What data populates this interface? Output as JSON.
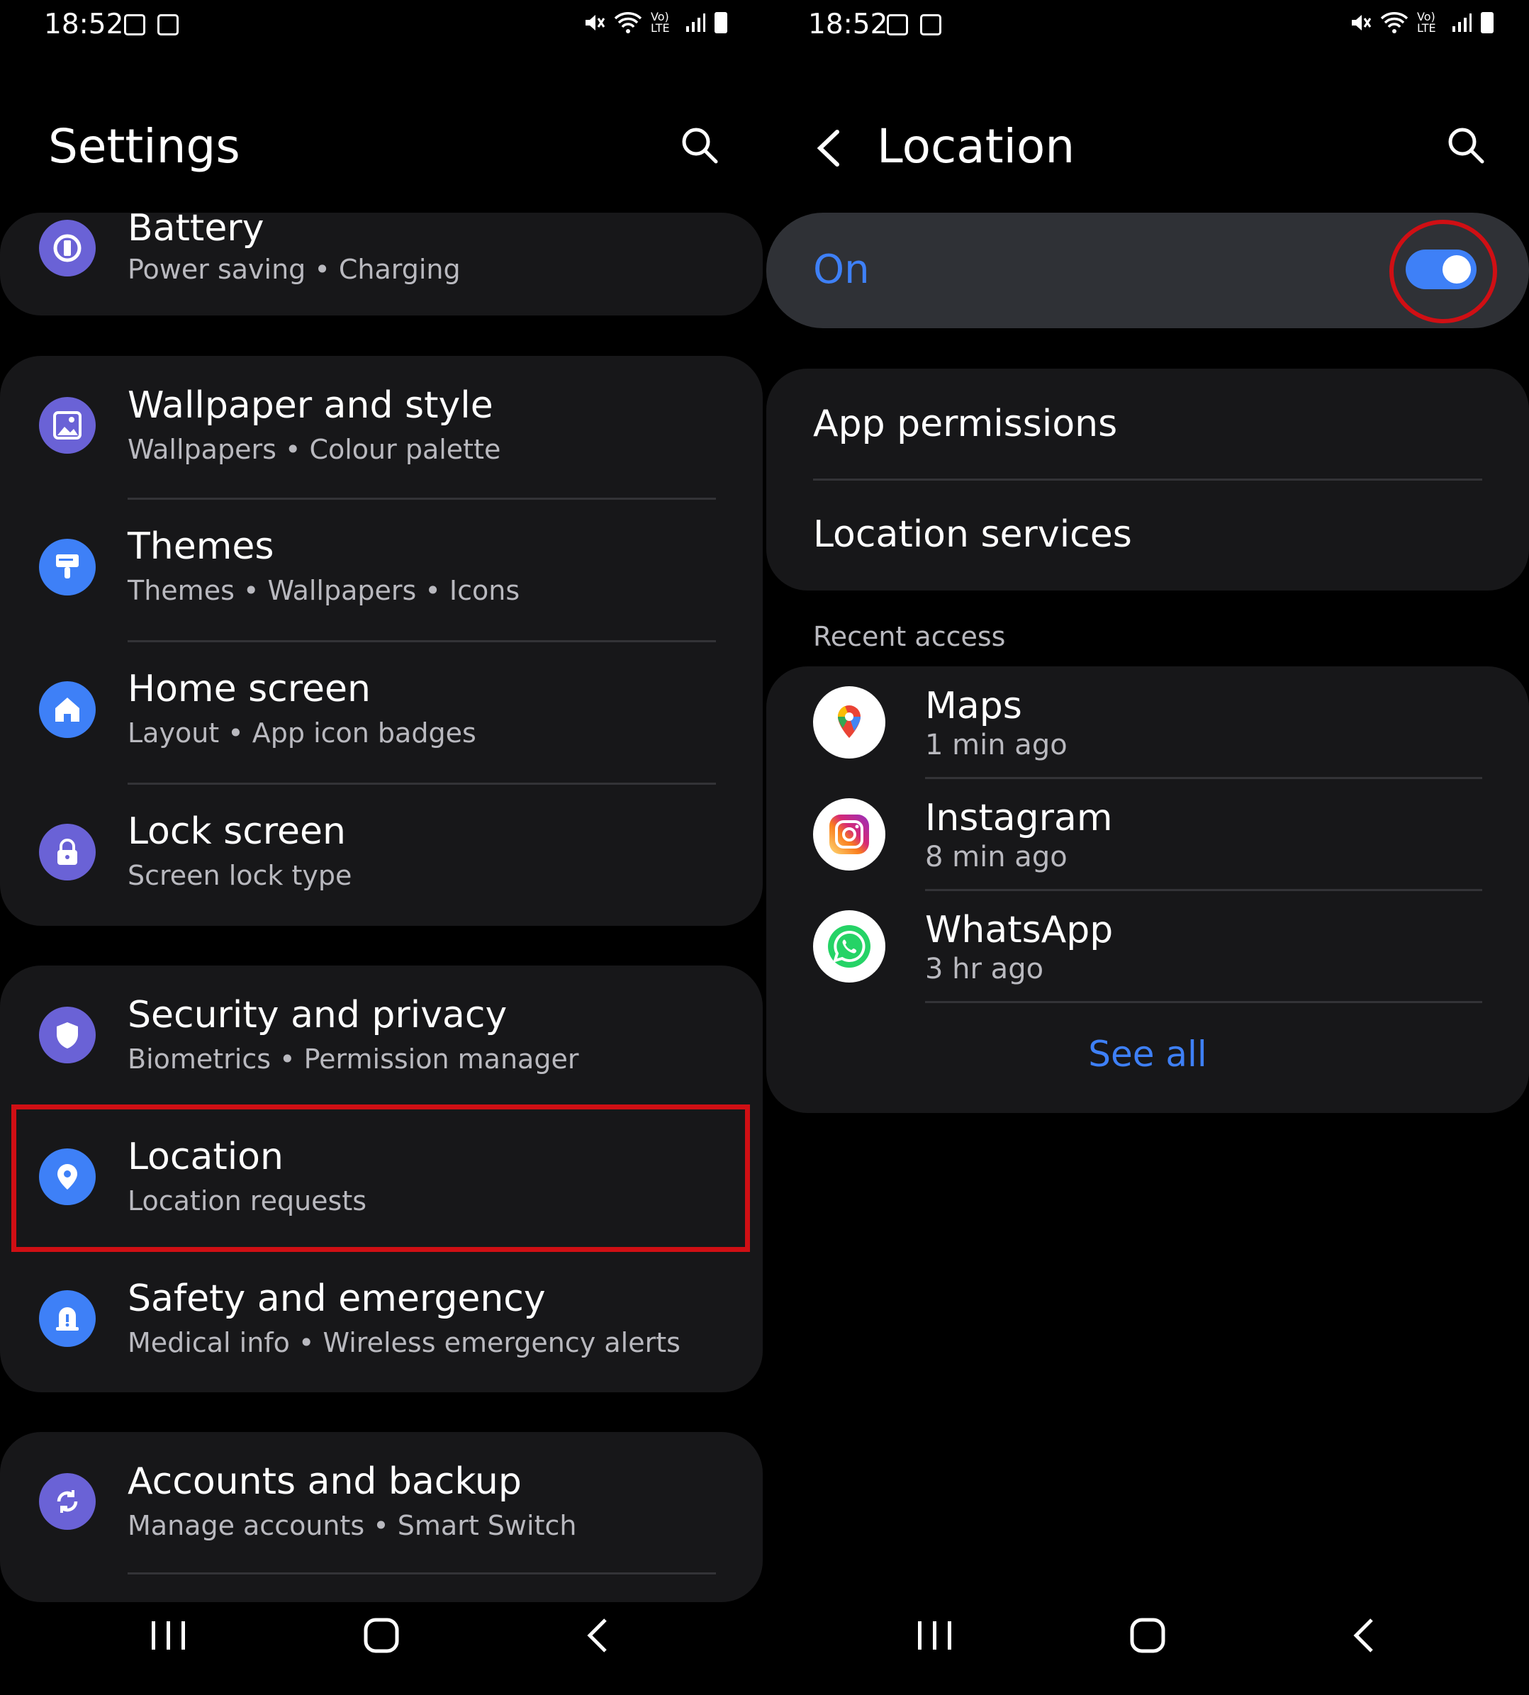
{
  "status": {
    "time": "18:52",
    "network": "Vo) LTE"
  },
  "left": {
    "title": "Settings",
    "items": [
      {
        "title": "Battery",
        "subtitle": "Power saving  •  Charging",
        "icon": "battery-icon",
        "color": "#6a62d6"
      },
      {
        "title": "Wallpaper and style",
        "subtitle": "Wallpapers  •  Colour palette",
        "icon": "wallpaper-icon",
        "color": "#6a62d6"
      },
      {
        "title": "Themes",
        "subtitle": "Themes  •  Wallpapers  •  Icons",
        "icon": "brush-icon",
        "color": "#3e80f7"
      },
      {
        "title": "Home screen",
        "subtitle": "Layout  •  App icon badges",
        "icon": "home-icon",
        "color": "#3e80f7"
      },
      {
        "title": "Lock screen",
        "subtitle": "Screen lock type",
        "icon": "lock-icon",
        "color": "#6a62d6"
      },
      {
        "title": "Security and privacy",
        "subtitle": "Biometrics  •  Permission manager",
        "icon": "shield-icon",
        "color": "#6a62d6"
      },
      {
        "title": "Location",
        "subtitle": "Location requests",
        "icon": "location-pin-icon",
        "color": "#3e80f7"
      },
      {
        "title": "Safety and emergency",
        "subtitle": "Medical info  •  Wireless emergency alerts",
        "icon": "alert-icon",
        "color": "#3e80f7"
      },
      {
        "title": "Accounts and backup",
        "subtitle": "Manage accounts  •  Smart Switch",
        "icon": "sync-icon",
        "color": "#6a62d6"
      }
    ]
  },
  "right": {
    "title": "Location",
    "toggle_label": "On",
    "toggle_on": true,
    "menu": [
      "App permissions",
      "Location services"
    ],
    "recent_header": "Recent access",
    "apps": [
      {
        "name": "Maps",
        "time": "1 min ago",
        "icon": "maps-icon"
      },
      {
        "name": "Instagram",
        "time": "8 min ago",
        "icon": "instagram-icon"
      },
      {
        "name": "WhatsApp",
        "time": "3 hr ago",
        "icon": "whatsapp-icon"
      }
    ],
    "see_all": "See all"
  },
  "colors": {
    "accent": "#3e80f7",
    "card": "#171719",
    "highlight": "#d00f14"
  }
}
